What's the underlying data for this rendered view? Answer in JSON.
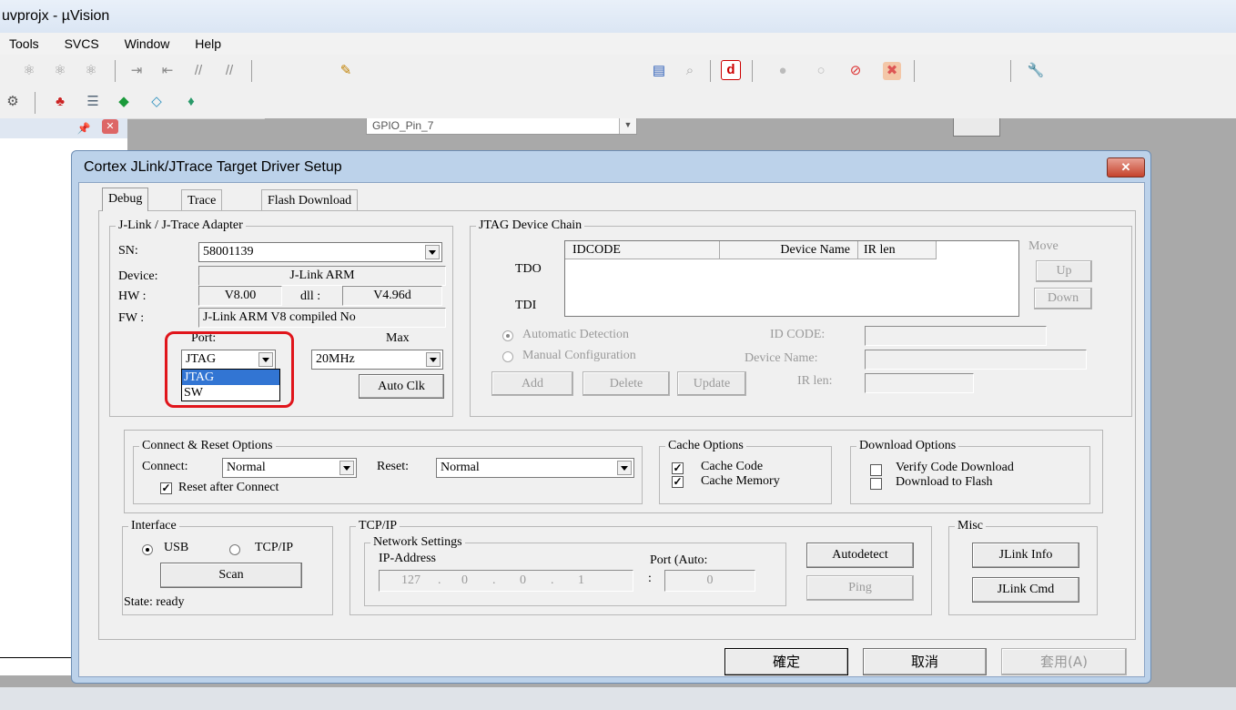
{
  "window": {
    "title": "uvprojx - µVision"
  },
  "menu": [
    "Tools",
    "SVCS",
    "Window",
    "Help"
  ],
  "toolbar": {
    "target_combo": "GPIO_Pin_7"
  },
  "dialog": {
    "title": "Cortex JLink/JTrace Target Driver Setup",
    "close_label": "✕",
    "tabs": [
      "Debug",
      "Trace",
      "Flash Download"
    ],
    "adapter": {
      "legend": "J-Link / J-Trace Adapter",
      "sn_label": "SN:",
      "sn_value": "58001139",
      "device_label": "Device:",
      "device_value": "J-Link ARM",
      "hw_label": "HW :",
      "hw_value": "V8.00",
      "dll_label": "dll :",
      "dll_value": "V4.96d",
      "fw_label": "FW :",
      "fw_value": "J-Link ARM V8 compiled No",
      "port_label": "Port:",
      "port_value": "JTAG",
      "port_options": [
        "JTAG",
        "SW"
      ],
      "max_label": "Max",
      "max_value": "20MHz",
      "autoclk_label": "Auto Clk"
    },
    "jtag_chain": {
      "legend": "JTAG Device Chain",
      "columns": [
        "IDCODE",
        "Device Name",
        "IR len"
      ],
      "tdo_label": "TDO",
      "tdi_label": "TDI",
      "move_label": "Move",
      "up_label": "Up",
      "down_label": "Down",
      "auto_detect_label": "Automatic Detection",
      "manual_config_label": "Manual Configuration",
      "idcode_label": "ID CODE:",
      "device_name_label": "Device Name:",
      "irlen_label": "IR len:",
      "add_label": "Add",
      "delete_label": "Delete",
      "update_label": "Update"
    },
    "connect_reset": {
      "legend": "Connect & Reset Options",
      "connect_label": "Connect:",
      "connect_value": "Normal",
      "reset_label": "Reset:",
      "reset_value": "Normal",
      "reset_after_connect_label": "Reset after Connect"
    },
    "cache": {
      "legend": "Cache Options",
      "cache_code_label": "Cache Code",
      "cache_memory_label": "Cache Memory"
    },
    "download": {
      "legend": "Download Options",
      "verify_label": "Verify Code Download",
      "download_flash_label": "Download to Flash"
    },
    "interface": {
      "legend": "Interface",
      "usb_label": "USB",
      "tcpip_label": "TCP/IP",
      "scan_label": "Scan",
      "state_text": "State: ready"
    },
    "tcpip": {
      "legend": "TCP/IP",
      "network_legend": "Network Settings",
      "ip_label": "IP-Address",
      "ip": [
        "127",
        "0",
        "0",
        "1"
      ],
      "port_label": "Port (Auto:",
      "port_value": "0",
      "autodetect_label": "Autodetect",
      "ping_label": "Ping"
    },
    "misc": {
      "legend": "Misc",
      "jlink_info_label": "JLink Info",
      "jlink_cmd_label": "JLink Cmd"
    },
    "buttons": {
      "ok": "確定",
      "cancel": "取消",
      "apply": "套用(A)"
    }
  }
}
